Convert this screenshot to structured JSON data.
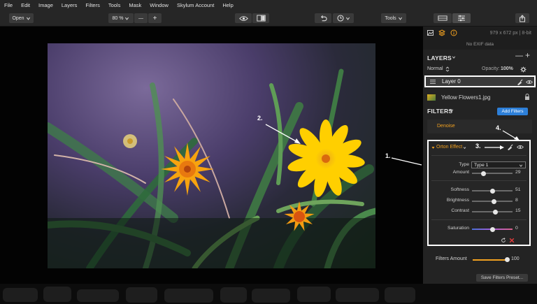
{
  "menu": [
    "File",
    "Edit",
    "Image",
    "Layers",
    "Filters",
    "Tools",
    "Mask",
    "Window",
    "Skylum Account",
    "Help"
  ],
  "toolbar": {
    "open_label": "Open",
    "zoom_value": "80 %",
    "minus": "—",
    "plus": "+",
    "tools_label": "Tools"
  },
  "panel": {
    "dims": "979 x 672 px  |  8-bit",
    "exif": "No EXIF data",
    "layers_title": "LAYERS",
    "blend_mode": "Normal",
    "opacity_label": "Opacity:",
    "opacity_value": "100%",
    "layer0_name": "Layer 0",
    "file_name": "Yellow Flowers1.jpg",
    "filters_title": "FILTERS",
    "add_filters": "Add Filters",
    "denoise": "Denoise",
    "orton": {
      "name": "Orton Effect",
      "type_label": "Type",
      "type_value": "Type 1",
      "sliders": [
        {
          "label": "Amount",
          "value": 29
        },
        {
          "label": "Softness",
          "value": 51
        },
        {
          "label": "Brightness",
          "value": 8
        },
        {
          "label": "Contrast",
          "value": 15
        },
        {
          "label": "Saturation",
          "value": 0
        }
      ]
    },
    "filters_amount_label": "Filters Amount",
    "filters_amount_value": 100,
    "save_filters": "Save Filters Preset..."
  },
  "annotations": [
    "1.",
    "2.",
    "3.",
    "4."
  ]
}
